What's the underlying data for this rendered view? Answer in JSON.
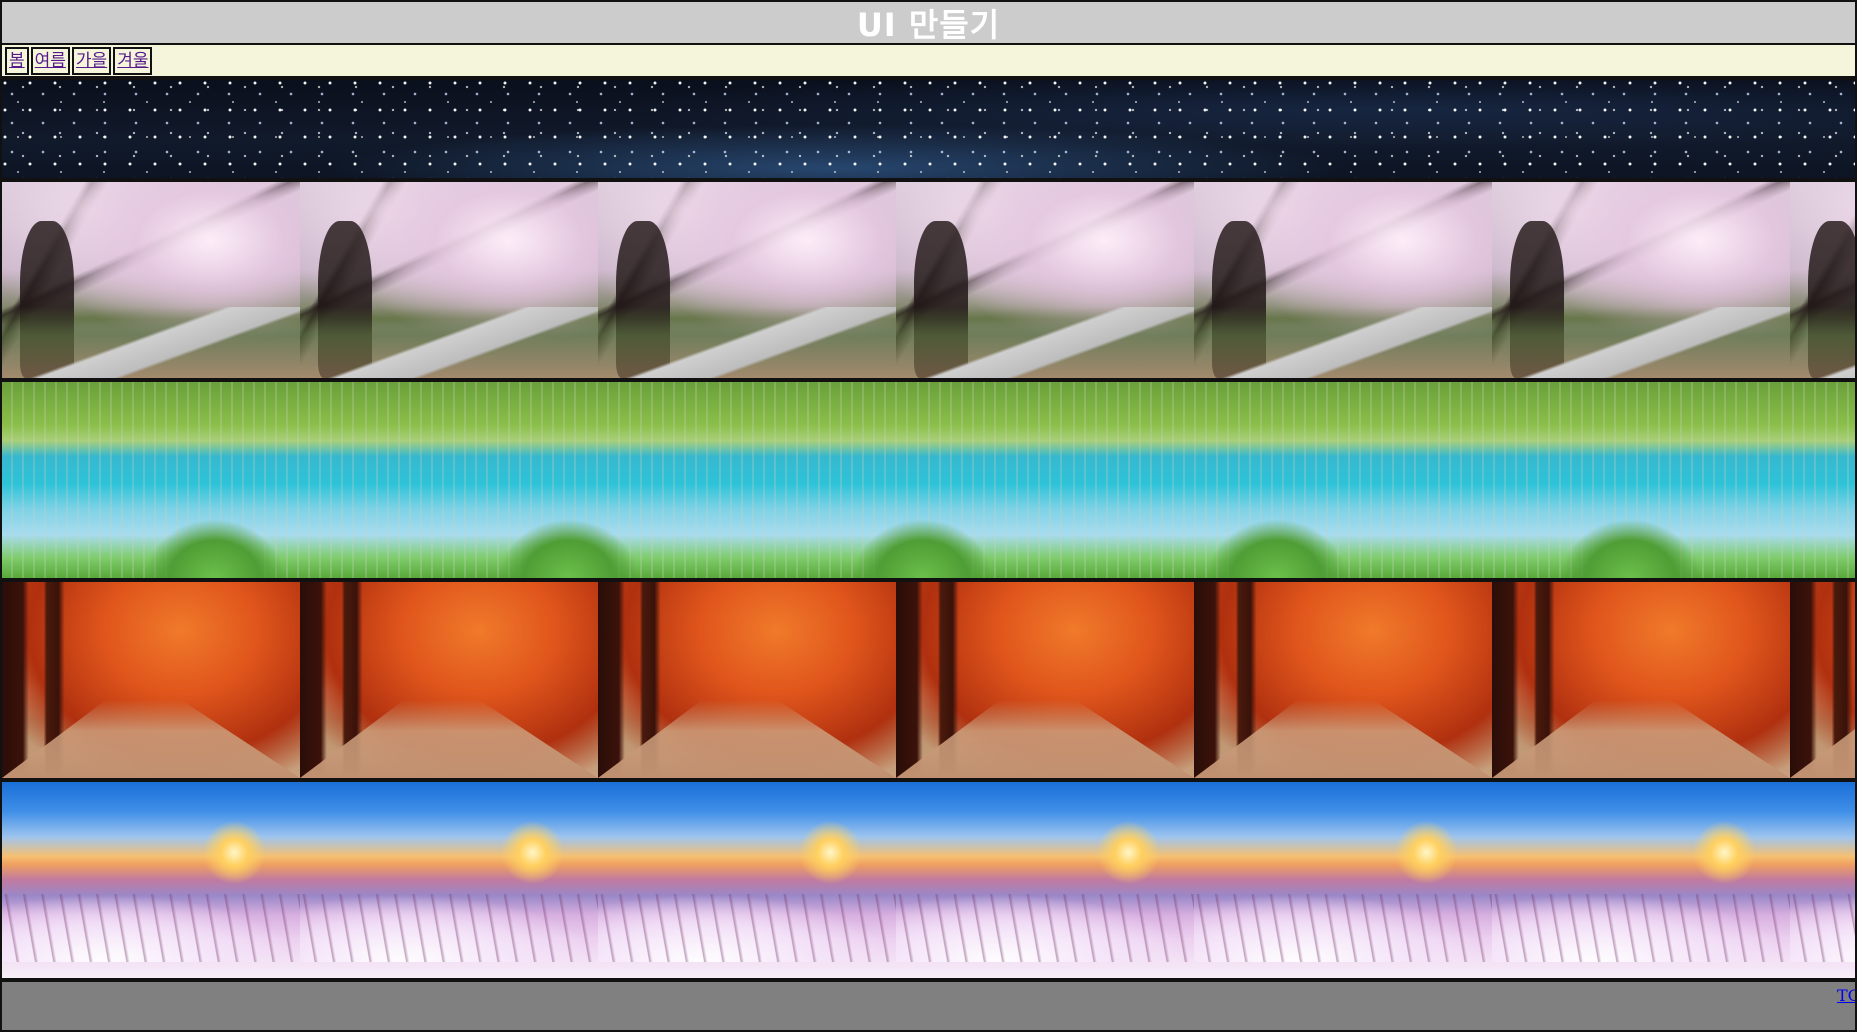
{
  "header": {
    "title": "UI 만들기"
  },
  "nav": {
    "items": [
      {
        "label": "봄"
      },
      {
        "label": "여름"
      },
      {
        "label": "가을"
      },
      {
        "label": "겨울"
      }
    ]
  },
  "footer": {
    "link_label": "TOP"
  },
  "colors": {
    "header_bg": "#cccccc",
    "nav_bg": "#f5f5dc",
    "footer_bg": "#808080",
    "border": "#111111",
    "link_visited": "#551a8b",
    "link": "#0000ee"
  }
}
